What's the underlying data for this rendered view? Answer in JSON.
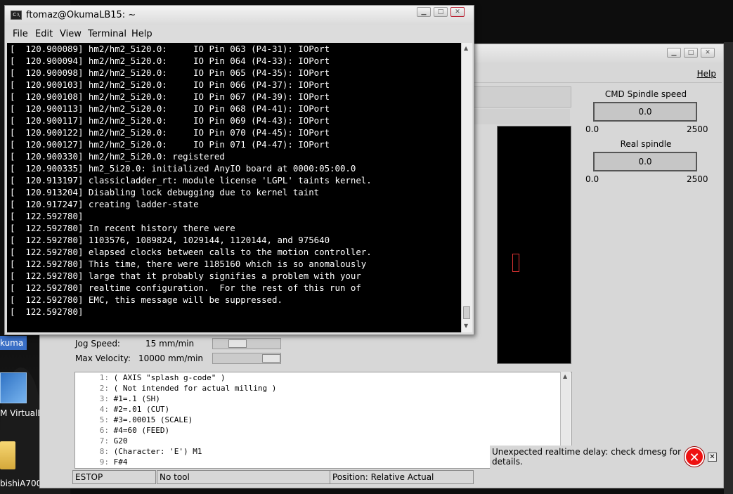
{
  "desktop": {
    "selected_icon_label": "kuma",
    "icons": [
      {
        "label": "M VirtualBox"
      },
      {
        "label": "bishiA700"
      }
    ]
  },
  "terminal": {
    "title": "ftomaz@OkumaLB15: ~",
    "menu": [
      "File",
      "Edit",
      "View",
      "Terminal",
      "Help"
    ],
    "lines": [
      "[  120.900089] hm2/hm2_5i20.0:     IO Pin 063 (P4-31): IOPort",
      "[  120.900094] hm2/hm2_5i20.0:     IO Pin 064 (P4-33): IOPort",
      "[  120.900098] hm2/hm2_5i20.0:     IO Pin 065 (P4-35): IOPort",
      "[  120.900103] hm2/hm2_5i20.0:     IO Pin 066 (P4-37): IOPort",
      "[  120.900108] hm2/hm2_5i20.0:     IO Pin 067 (P4-39): IOPort",
      "[  120.900113] hm2/hm2_5i20.0:     IO Pin 068 (P4-41): IOPort",
      "[  120.900117] hm2/hm2_5i20.0:     IO Pin 069 (P4-43): IOPort",
      "[  120.900122] hm2/hm2_5i20.0:     IO Pin 070 (P4-45): IOPort",
      "[  120.900127] hm2/hm2_5i20.0:     IO Pin 071 (P4-47): IOPort",
      "[  120.900330] hm2/hm2_5i20.0: registered",
      "[  120.900335] hm2_5i20.0: initialized AnyIO board at 0000:05:00.0",
      "[  120.913197] classicladder_rt: module license 'LGPL' taints kernel.",
      "[  120.913204] Disabling lock debugging due to kernel taint",
      "[  120.917247] creating ladder-state",
      "[  122.592780]",
      "[  122.592780] In recent history there were",
      "[  122.592780] 1103576, 1089824, 1029144, 1120144, and 975640",
      "[  122.592780] elapsed clocks between calls to the motion controller.",
      "[  122.592780] This time, there were 1185160 which is so anomalously",
      "[  122.592780] large that it probably signifies a problem with your",
      "[  122.592780] realtime configuration.  For the rest of this run of",
      "[  122.592780] EMC, this message will be suppressed.",
      "[  122.592780]"
    ]
  },
  "axis": {
    "menu_help": "Help",
    "cmd_spindle": {
      "label": "CMD Spindle speed",
      "value": "0.0",
      "min": "0.0",
      "max": "2500"
    },
    "real_spindle": {
      "label": "Real spindle",
      "value": "0.0",
      "min": "0.0",
      "max": "2500"
    },
    "jog_speed": {
      "label": "Jog Speed:",
      "value": "15 mm/min"
    },
    "max_velocity": {
      "label": "Max Velocity:",
      "value": "10000 mm/min"
    },
    "gcode": [
      {
        "n": "1:",
        "text": "( AXIS \"splash g-code\" )"
      },
      {
        "n": "2:",
        "text": "( Not intended for actual milling )"
      },
      {
        "n": "3:",
        "text": "#1=.1 (SH)"
      },
      {
        "n": "4:",
        "text": "#2=.01 (CUT)"
      },
      {
        "n": "5:",
        "text": "#3=.00015 (SCALE)"
      },
      {
        "n": "6:",
        "text": "#4=60 (FEED)"
      },
      {
        "n": "7:",
        "text": "G20"
      },
      {
        "n": "8:",
        "text": "(Character: 'E') M1"
      },
      {
        "n": "9:",
        "text": "F#4"
      }
    ],
    "status": {
      "estop": "ESTOP",
      "tool": "No tool",
      "position": "Position: Relative Actual"
    }
  },
  "notification": {
    "text": "Unexpected realtime delay: check dmesg for details.",
    "icon": "error-icon"
  }
}
